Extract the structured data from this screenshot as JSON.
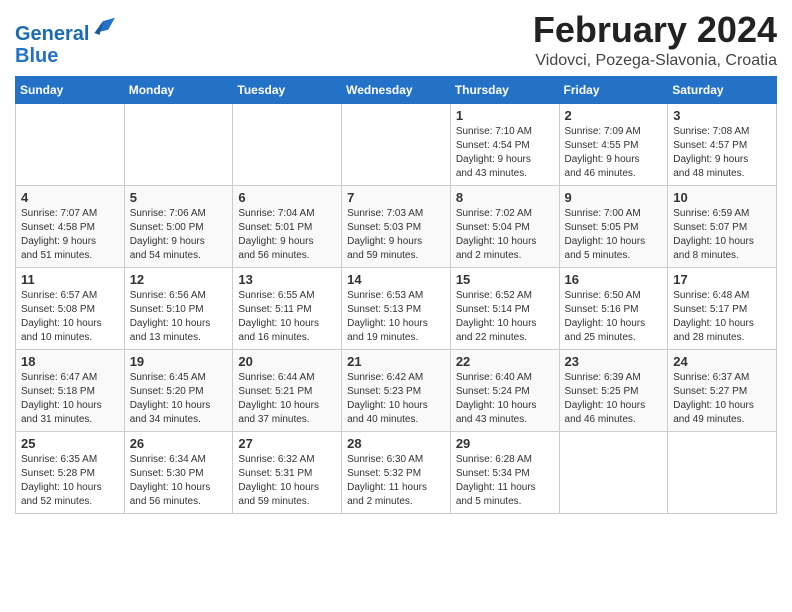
{
  "logo": {
    "line1": "General",
    "line2": "Blue"
  },
  "title": "February 2024",
  "location": "Vidovci, Pozega-Slavonia, Croatia",
  "headers": [
    "Sunday",
    "Monday",
    "Tuesday",
    "Wednesday",
    "Thursday",
    "Friday",
    "Saturday"
  ],
  "weeks": [
    [
      {
        "day": "",
        "detail": ""
      },
      {
        "day": "",
        "detail": ""
      },
      {
        "day": "",
        "detail": ""
      },
      {
        "day": "",
        "detail": ""
      },
      {
        "day": "1",
        "detail": "Sunrise: 7:10 AM\nSunset: 4:54 PM\nDaylight: 9 hours\nand 43 minutes."
      },
      {
        "day": "2",
        "detail": "Sunrise: 7:09 AM\nSunset: 4:55 PM\nDaylight: 9 hours\nand 46 minutes."
      },
      {
        "day": "3",
        "detail": "Sunrise: 7:08 AM\nSunset: 4:57 PM\nDaylight: 9 hours\nand 48 minutes."
      }
    ],
    [
      {
        "day": "4",
        "detail": "Sunrise: 7:07 AM\nSunset: 4:58 PM\nDaylight: 9 hours\nand 51 minutes."
      },
      {
        "day": "5",
        "detail": "Sunrise: 7:06 AM\nSunset: 5:00 PM\nDaylight: 9 hours\nand 54 minutes."
      },
      {
        "day": "6",
        "detail": "Sunrise: 7:04 AM\nSunset: 5:01 PM\nDaylight: 9 hours\nand 56 minutes."
      },
      {
        "day": "7",
        "detail": "Sunrise: 7:03 AM\nSunset: 5:03 PM\nDaylight: 9 hours\nand 59 minutes."
      },
      {
        "day": "8",
        "detail": "Sunrise: 7:02 AM\nSunset: 5:04 PM\nDaylight: 10 hours\nand 2 minutes."
      },
      {
        "day": "9",
        "detail": "Sunrise: 7:00 AM\nSunset: 5:05 PM\nDaylight: 10 hours\nand 5 minutes."
      },
      {
        "day": "10",
        "detail": "Sunrise: 6:59 AM\nSunset: 5:07 PM\nDaylight: 10 hours\nand 8 minutes."
      }
    ],
    [
      {
        "day": "11",
        "detail": "Sunrise: 6:57 AM\nSunset: 5:08 PM\nDaylight: 10 hours\nand 10 minutes."
      },
      {
        "day": "12",
        "detail": "Sunrise: 6:56 AM\nSunset: 5:10 PM\nDaylight: 10 hours\nand 13 minutes."
      },
      {
        "day": "13",
        "detail": "Sunrise: 6:55 AM\nSunset: 5:11 PM\nDaylight: 10 hours\nand 16 minutes."
      },
      {
        "day": "14",
        "detail": "Sunrise: 6:53 AM\nSunset: 5:13 PM\nDaylight: 10 hours\nand 19 minutes."
      },
      {
        "day": "15",
        "detail": "Sunrise: 6:52 AM\nSunset: 5:14 PM\nDaylight: 10 hours\nand 22 minutes."
      },
      {
        "day": "16",
        "detail": "Sunrise: 6:50 AM\nSunset: 5:16 PM\nDaylight: 10 hours\nand 25 minutes."
      },
      {
        "day": "17",
        "detail": "Sunrise: 6:48 AM\nSunset: 5:17 PM\nDaylight: 10 hours\nand 28 minutes."
      }
    ],
    [
      {
        "day": "18",
        "detail": "Sunrise: 6:47 AM\nSunset: 5:18 PM\nDaylight: 10 hours\nand 31 minutes."
      },
      {
        "day": "19",
        "detail": "Sunrise: 6:45 AM\nSunset: 5:20 PM\nDaylight: 10 hours\nand 34 minutes."
      },
      {
        "day": "20",
        "detail": "Sunrise: 6:44 AM\nSunset: 5:21 PM\nDaylight: 10 hours\nand 37 minutes."
      },
      {
        "day": "21",
        "detail": "Sunrise: 6:42 AM\nSunset: 5:23 PM\nDaylight: 10 hours\nand 40 minutes."
      },
      {
        "day": "22",
        "detail": "Sunrise: 6:40 AM\nSunset: 5:24 PM\nDaylight: 10 hours\nand 43 minutes."
      },
      {
        "day": "23",
        "detail": "Sunrise: 6:39 AM\nSunset: 5:25 PM\nDaylight: 10 hours\nand 46 minutes."
      },
      {
        "day": "24",
        "detail": "Sunrise: 6:37 AM\nSunset: 5:27 PM\nDaylight: 10 hours\nand 49 minutes."
      }
    ],
    [
      {
        "day": "25",
        "detail": "Sunrise: 6:35 AM\nSunset: 5:28 PM\nDaylight: 10 hours\nand 52 minutes."
      },
      {
        "day": "26",
        "detail": "Sunrise: 6:34 AM\nSunset: 5:30 PM\nDaylight: 10 hours\nand 56 minutes."
      },
      {
        "day": "27",
        "detail": "Sunrise: 6:32 AM\nSunset: 5:31 PM\nDaylight: 10 hours\nand 59 minutes."
      },
      {
        "day": "28",
        "detail": "Sunrise: 6:30 AM\nSunset: 5:32 PM\nDaylight: 11 hours\nand 2 minutes."
      },
      {
        "day": "29",
        "detail": "Sunrise: 6:28 AM\nSunset: 5:34 PM\nDaylight: 11 hours\nand 5 minutes."
      },
      {
        "day": "",
        "detail": ""
      },
      {
        "day": "",
        "detail": ""
      }
    ]
  ]
}
